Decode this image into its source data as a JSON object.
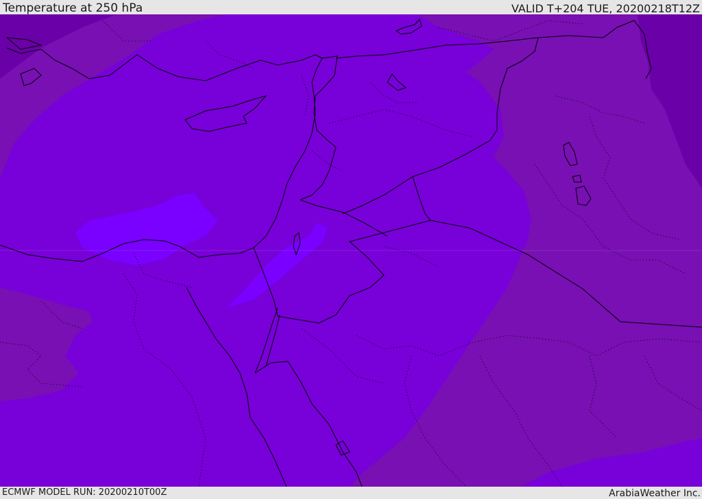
{
  "header": {
    "title": "Temperature at 250 hPa",
    "valid": "VALID T+204 TUE, 20200218T12Z"
  },
  "footer": {
    "model_run": "ECMWF MODEL RUN: 20200210T00Z",
    "credit": "ArabiaWeather Inc."
  },
  "colors": {
    "dark_violet": "#6a00a8",
    "medium_violet": "#7810b3",
    "main_violet": "#7800d8",
    "light_violet": "#7a00ff",
    "border": "#000000",
    "bars": "#e6e6e6"
  },
  "map_layers": [
    "temperature-shading",
    "coastlines",
    "country-borders",
    "province-borders"
  ]
}
